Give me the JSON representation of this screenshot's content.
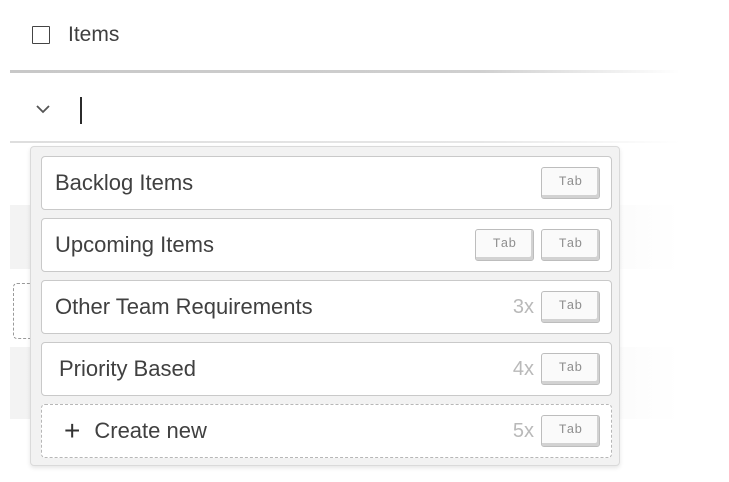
{
  "header": {
    "label": "Items"
  },
  "input": {
    "icon": "chevron-down-icon",
    "value": ""
  },
  "menu": {
    "items": [
      {
        "label": "Backlog Items",
        "count": "",
        "keys": [
          "Tab"
        ]
      },
      {
        "label": "Upcoming Items",
        "count": "",
        "keys": [
          "Tab",
          "Tab"
        ]
      },
      {
        "label": "Other Team Requirements",
        "count": "3x",
        "keys": [
          "Tab"
        ]
      },
      {
        "label": "Priority Based",
        "count": "4x",
        "keys": [
          "Tab"
        ]
      }
    ],
    "create": {
      "icon": "plus-icon",
      "label": "Create new",
      "count": "5x",
      "key": "Tab"
    }
  }
}
